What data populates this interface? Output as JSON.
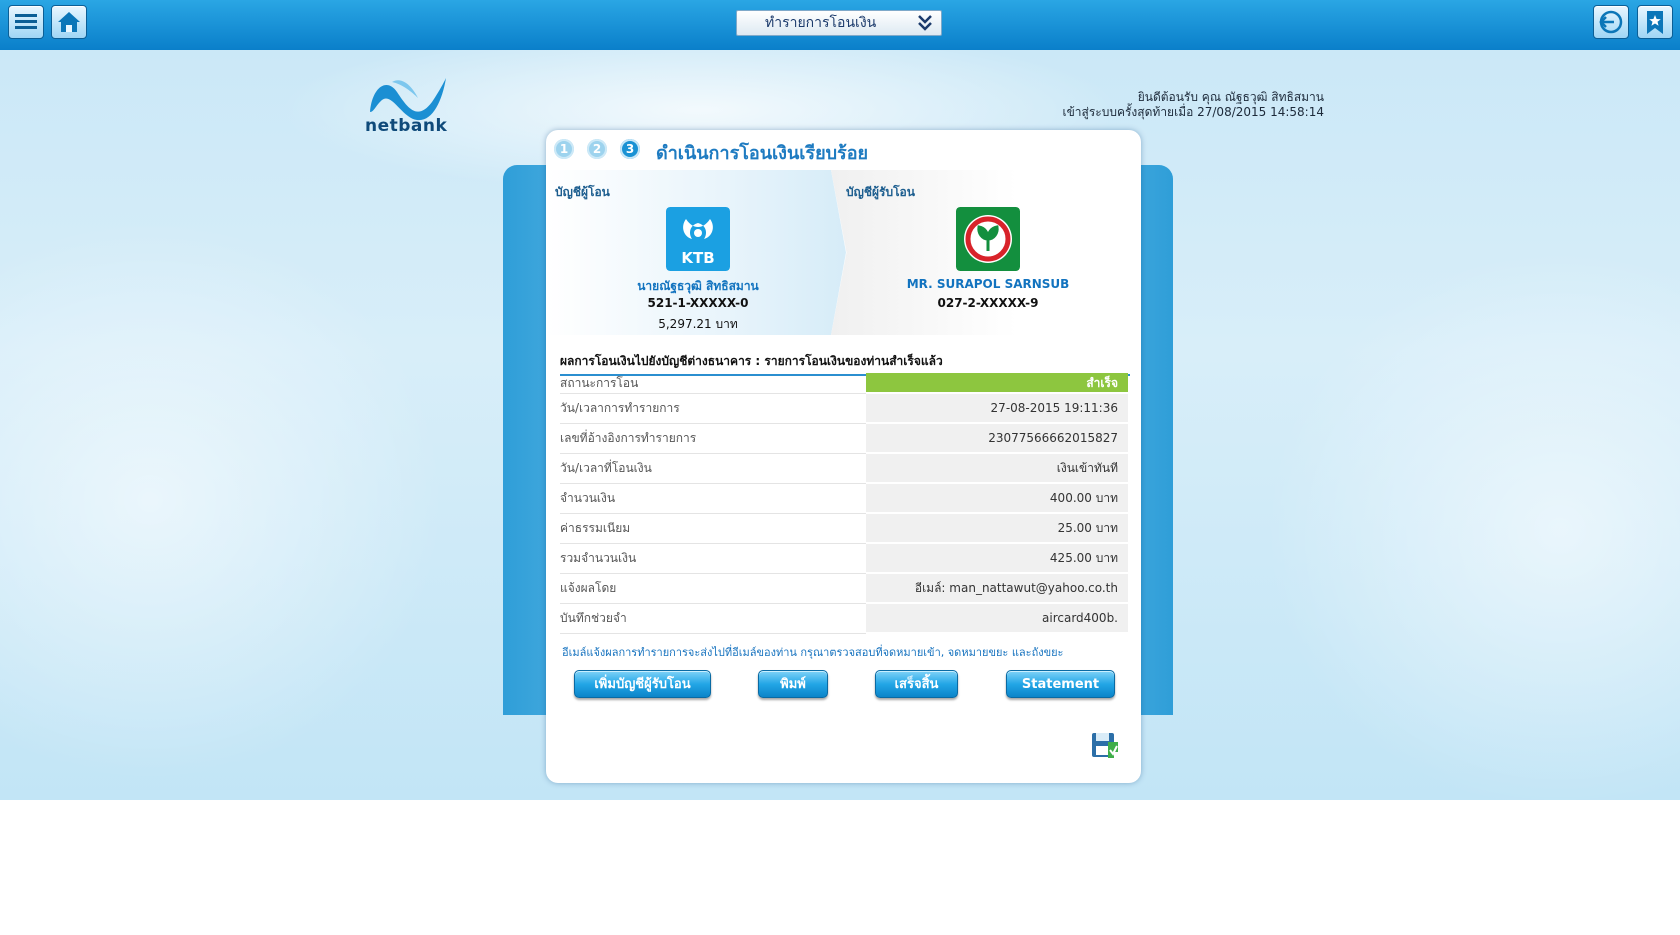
{
  "topbar": {
    "menu_select_label": "ทำรายการโอนเงิน"
  },
  "logo": {
    "text": "netbank"
  },
  "welcome": {
    "greeting": "ยินดีต้อนรับ คุณ ณัฐธวุฒิ สิทธิสมาน",
    "last_login": "เข้าสู่ระบบครั้งสุดท้ายเมื่อ 27/08/2015 14:58:14"
  },
  "steps": [
    "1",
    "2",
    "3"
  ],
  "card": {
    "title": "ดำเนินการโอนเงินเรียบร้อย",
    "from": {
      "label": "บัญชีผู้โอน",
      "bank": "KTB",
      "name": "นายณัฐธวุฒิ สิทธิสมาน",
      "account_no": "521-1-XXXXX-0",
      "balance": "5,297.21 บาท",
      "color": "#1ba0e2"
    },
    "to": {
      "label": "บัญชีผู้รับโอน",
      "name": "MR. SURAPOL SARNSUB",
      "account_no": "027-2-XXXXX-9",
      "color": "#138f3e"
    },
    "result_title": "ผลการโอนเงินไปยังบัญชีต่างธนาคาร : รายการโอนเงินของท่านสำเร็จแล้ว",
    "rows": [
      {
        "label": "สถานะการโอน",
        "value": "สำเร็จ"
      },
      {
        "label": "วัน/เวลาการทำรายการ",
        "value": "27-08-2015 19:11:36"
      },
      {
        "label": "เลขที่อ้างอิงการทำรายการ",
        "value": "23077566662015827"
      },
      {
        "label": "วัน/เวลาที่โอนเงิน",
        "value": "เงินเข้าทันที"
      },
      {
        "label": "จำนวนเงิน",
        "value": "400.00 บาท"
      },
      {
        "label": "ค่าธรรมเนียม",
        "value": "25.00 บาท"
      },
      {
        "label": "รวมจำนวนเงิน",
        "value": "425.00 บาท"
      },
      {
        "label": "แจ้งผลโดย",
        "value": "อีเมล์: man_nattawut@yahoo.co.th"
      },
      {
        "label": "บันทึกช่วยจำ",
        "value": "aircard400b."
      }
    ],
    "note": "อีเมล์แจ้งผลการทำรายการจะส่งไปที่อีเมล์ของท่าน กรุณาตรวจสอบที่จดหมายเข้า, จดหมายขยะ และถังขยะ",
    "buttons": {
      "add_payee": "เพิ่มบัญชีผู้รับโอน",
      "print": "พิมพ์",
      "done": "เสร็จสิ้น",
      "statement": "Statement"
    }
  },
  "colors": {
    "topbar": "#0a7fca",
    "accent": "#1e7bc1",
    "success": "#8dc63f"
  }
}
